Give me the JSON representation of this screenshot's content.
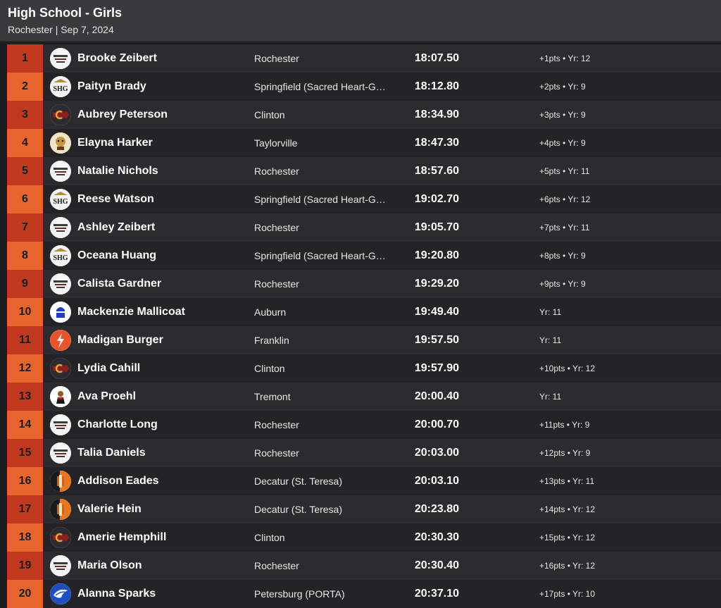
{
  "header": {
    "title": "High School - Girls",
    "subtitle": "Rochester | Sep 7, 2024"
  },
  "colors": {
    "place_odd": "#c0391f",
    "place_even": "#e8642d",
    "row_odd": "#2c2c2e",
    "row_even": "#242426"
  },
  "results": [
    {
      "place": "1",
      "name": "Brooke Zeibert",
      "school": "Rochester",
      "time": "18:07.50",
      "meta": "+1pts • Yr: 12",
      "logo": "rochester-logo"
    },
    {
      "place": "2",
      "name": "Paityn Brady",
      "school": "Springfield (Sacred Heart-G…",
      "time": "18:12.80",
      "meta": "+2pts • Yr: 9",
      "logo": "shg-logo"
    },
    {
      "place": "3",
      "name": "Aubrey Peterson",
      "school": "Clinton",
      "time": "18:34.90",
      "meta": "+3pts • Yr: 9",
      "logo": "clinton-logo"
    },
    {
      "place": "4",
      "name": "Elayna Harker",
      "school": "Taylorville",
      "time": "18:47.30",
      "meta": "+4pts • Yr: 9",
      "logo": "taylorville-logo"
    },
    {
      "place": "5",
      "name": "Natalie Nichols",
      "school": "Rochester",
      "time": "18:57.60",
      "meta": "+5pts • Yr: 11",
      "logo": "rochester-logo"
    },
    {
      "place": "6",
      "name": "Reese Watson",
      "school": "Springfield (Sacred Heart-G…",
      "time": "19:02.70",
      "meta": "+6pts • Yr: 12",
      "logo": "shg-logo"
    },
    {
      "place": "7",
      "name": "Ashley Zeibert",
      "school": "Rochester",
      "time": "19:05.70",
      "meta": "+7pts • Yr: 11",
      "logo": "rochester-logo"
    },
    {
      "place": "8",
      "name": "Oceana Huang",
      "school": "Springfield (Sacred Heart-G…",
      "time": "19:20.80",
      "meta": "+8pts • Yr: 9",
      "logo": "shg-logo"
    },
    {
      "place": "9",
      "name": "Calista Gardner",
      "school": "Rochester",
      "time": "19:29.20",
      "meta": "+9pts • Yr: 9",
      "logo": "rochester-logo"
    },
    {
      "place": "10",
      "name": "Mackenzie Mallicoat",
      "school": "Auburn",
      "time": "19:49.40",
      "meta": "Yr: 11",
      "logo": "auburn-logo"
    },
    {
      "place": "11",
      "name": "Madigan Burger",
      "school": "Franklin",
      "time": "19:57.50",
      "meta": "Yr: 11",
      "logo": "franklin-logo"
    },
    {
      "place": "12",
      "name": "Lydia Cahill",
      "school": "Clinton",
      "time": "19:57.90",
      "meta": "+10pts • Yr: 12",
      "logo": "clinton-logo"
    },
    {
      "place": "13",
      "name": "Ava Proehl",
      "school": "Tremont",
      "time": "20:00.40",
      "meta": "Yr: 11",
      "logo": "tremont-logo"
    },
    {
      "place": "14",
      "name": "Charlotte Long",
      "school": "Rochester",
      "time": "20:00.70",
      "meta": "+11pts • Yr: 9",
      "logo": "rochester-logo"
    },
    {
      "place": "15",
      "name": "Talia Daniels",
      "school": "Rochester",
      "time": "20:03.00",
      "meta": "+12pts • Yr: 9",
      "logo": "rochester-logo"
    },
    {
      "place": "16",
      "name": "Addison Eades",
      "school": "Decatur (St. Teresa)",
      "time": "20:03.10",
      "meta": "+13pts • Yr: 11",
      "logo": "st-teresa-logo"
    },
    {
      "place": "17",
      "name": "Valerie Hein",
      "school": "Decatur (St. Teresa)",
      "time": "20:23.80",
      "meta": "+14pts • Yr: 12",
      "logo": "st-teresa-logo"
    },
    {
      "place": "18",
      "name": "Amerie Hemphill",
      "school": "Clinton",
      "time": "20:30.30",
      "meta": "+15pts • Yr: 12",
      "logo": "clinton-logo"
    },
    {
      "place": "19",
      "name": "Maria Olson",
      "school": "Rochester",
      "time": "20:30.40",
      "meta": "+16pts • Yr: 12",
      "logo": "rochester-logo"
    },
    {
      "place": "20",
      "name": "Alanna Sparks",
      "school": "Petersburg (PORTA)",
      "time": "20:37.10",
      "meta": "+17pts • Yr: 10",
      "logo": "porta-logo"
    }
  ]
}
